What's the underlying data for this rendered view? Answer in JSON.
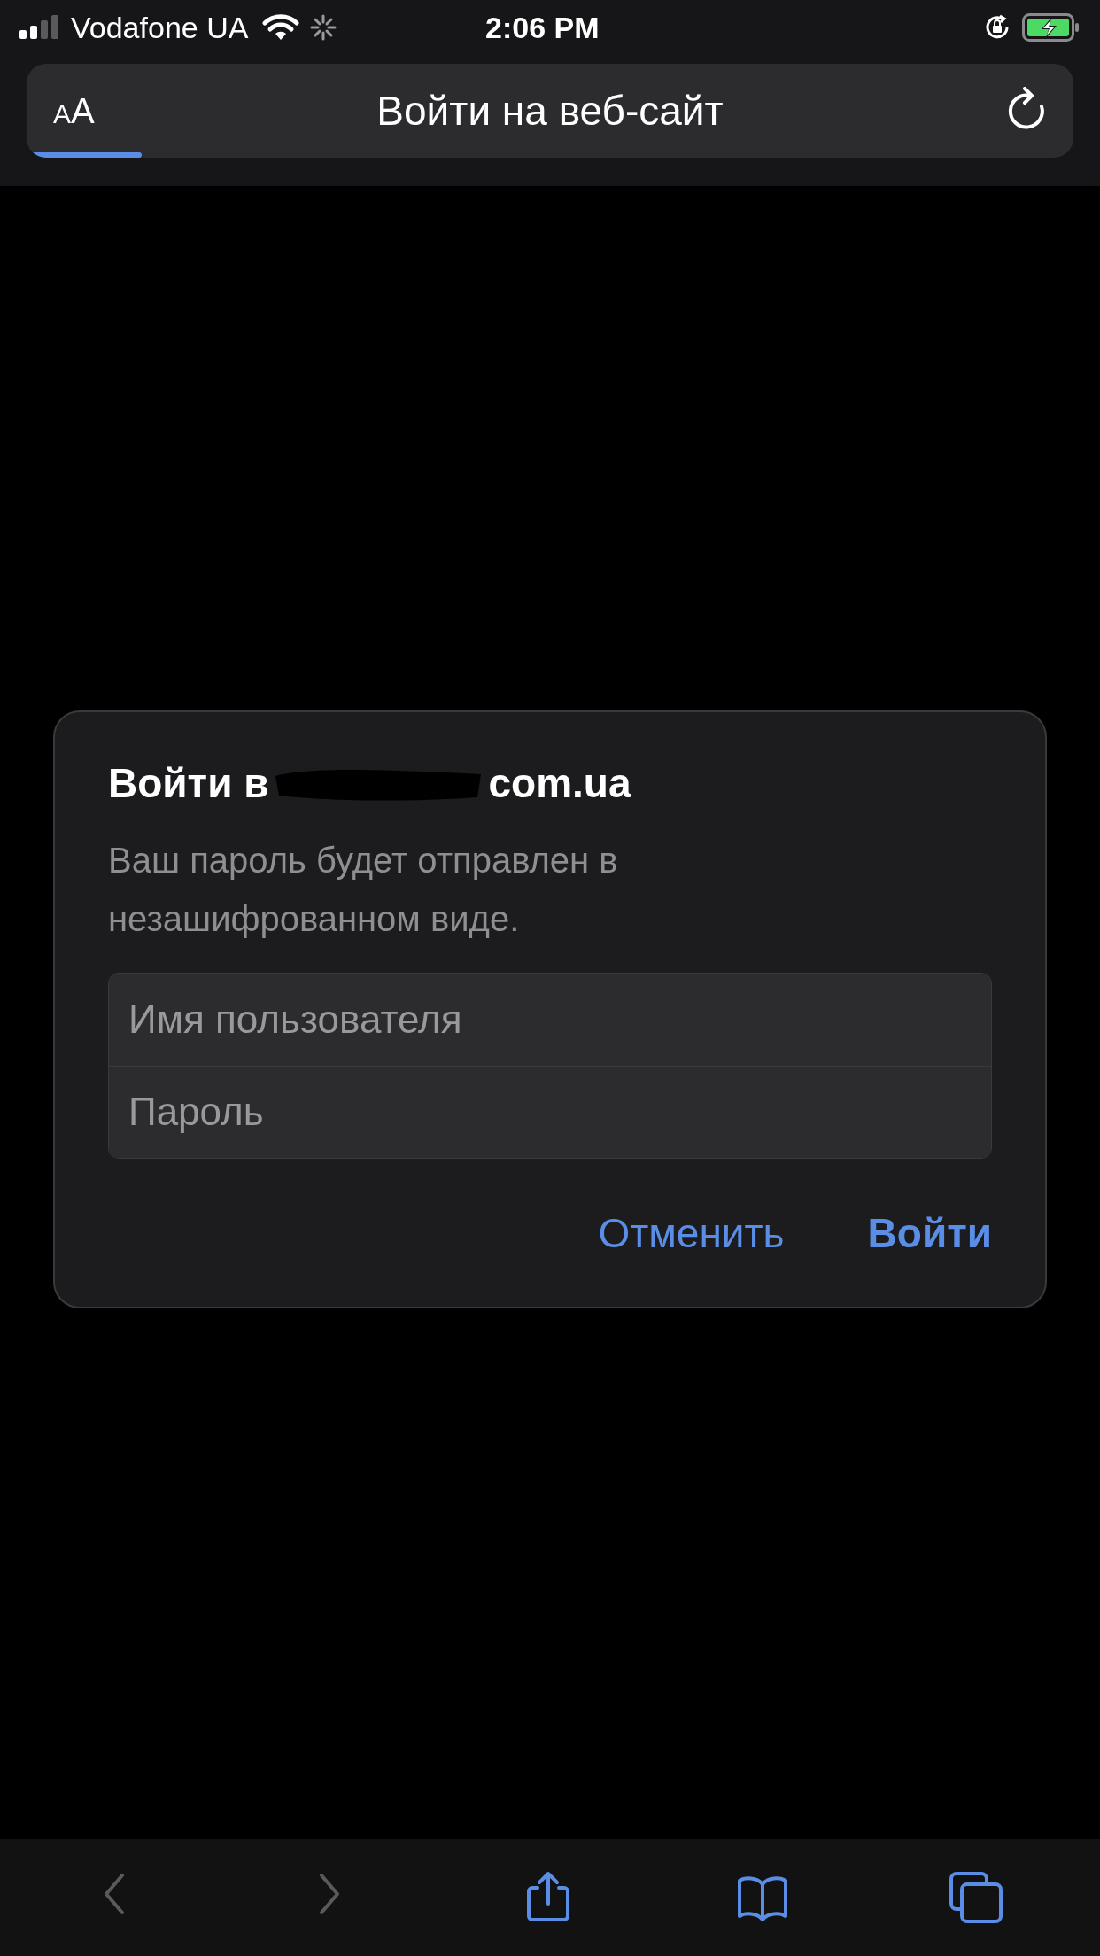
{
  "status_bar": {
    "carrier": "Vodafone UA",
    "time": "2:06 PM"
  },
  "address_bar": {
    "text_size_label": "AA",
    "title": "Войти на веб-сайт",
    "level": 0.11
  },
  "dialog": {
    "title_parts": [
      "Войти в",
      "com.ua"
    ],
    "message": "Ваш пароль будет отправлен в незашифрованном виде.",
    "fields": [
      {
        "placeholder": "Имя пользователя"
      },
      {
        "placeholder": "Пароль"
      }
    ],
    "buttons": [
      {
        "label": "Отменить",
        "kind": "cancel"
      },
      {
        "label": "Войти",
        "kind": "default"
      }
    ]
  },
  "toolbar": [
    {
      "kind": "back",
      "disabled": true
    },
    {
      "kind": "forward",
      "disabled": true
    },
    {
      "kind": "share",
      "disabled": false
    },
    {
      "kind": "bookmarks",
      "disabled": false
    },
    {
      "kind": "tabs",
      "disabled": false
    }
  ]
}
